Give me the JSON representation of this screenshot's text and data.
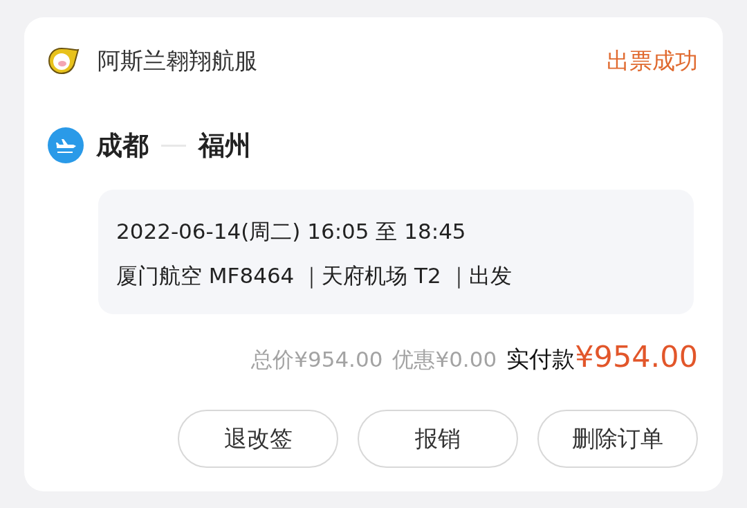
{
  "order": {
    "vendor": "阿斯兰翱翔航服",
    "status": "出票成功",
    "route": {
      "from": "成都",
      "to": "福州"
    },
    "flight_lines": [
      "2022-06-14(周二) 16:05 至 18:45",
      "厦门航空 MF8464 ｜天府机场 T2 ｜出发"
    ],
    "price": {
      "total": "总价¥954.00",
      "discount": "优惠¥0.00",
      "paid_label": "实付款",
      "paid_amount": "¥954.00"
    },
    "buttons": [
      "退改签",
      "报销",
      "删除订单"
    ]
  }
}
